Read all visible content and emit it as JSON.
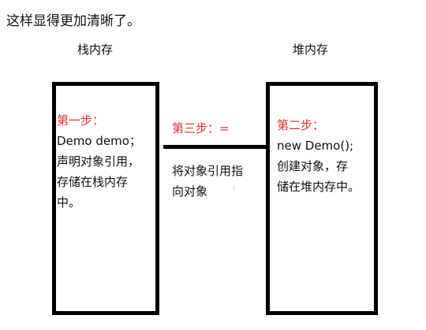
{
  "intro": "这样显得更加清晰了。",
  "stack": {
    "title": "栈内存",
    "step_label": "第一步：",
    "lines": [
      "Demo demo；",
      "声明对象引用，",
      "存储在栈内存",
      "中。"
    ]
  },
  "heap": {
    "title": "堆内存",
    "step_label": "第二步：",
    "lines": [
      "new Demo();",
      "创建对象，存",
      "储在堆内存中。"
    ]
  },
  "connector": {
    "step_label": "第三步：=",
    "lines": [
      "将对象引用指",
      "向对象"
    ]
  },
  "colors": {
    "step": "#e03030",
    "box_border": "#000000"
  }
}
